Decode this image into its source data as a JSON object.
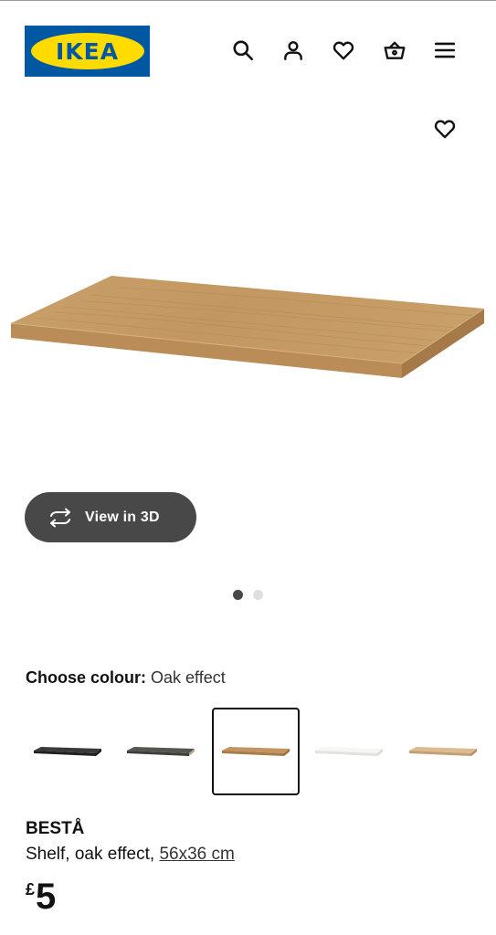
{
  "header": {
    "logo_text": "IKEA",
    "icons": [
      "search-icon",
      "account-icon",
      "favourites-icon",
      "basket-icon",
      "menu-icon"
    ]
  },
  "product_image": {
    "colors": {
      "top": "#c59a63",
      "front": "#b88c58",
      "side": "#a57a48"
    }
  },
  "view3d": {
    "label": "View in 3D",
    "icon": "rotate-3d-icon"
  },
  "carousel": {
    "count": 2,
    "active_index": 0
  },
  "colour_selector": {
    "label": "Choose colour:",
    "selected": "Oak effect",
    "swatches": [
      {
        "color": "#2b2b2b",
        "selected": false
      },
      {
        "color": "#4a4b45",
        "selected": false
      },
      {
        "color": "#b98c5a",
        "selected": true
      },
      {
        "color": "#f4f4f2",
        "selected": false
      },
      {
        "color": "#d9b78f",
        "selected": false
      }
    ]
  },
  "product": {
    "name": "BESTÅ",
    "description": "Shelf, oak effect,",
    "size": "56x36 cm",
    "currency": "£",
    "price": "5"
  },
  "colors": {
    "ikea_blue": "#0058a3",
    "ikea_yellow": "#ffdb00",
    "button_dark": "#484848"
  }
}
